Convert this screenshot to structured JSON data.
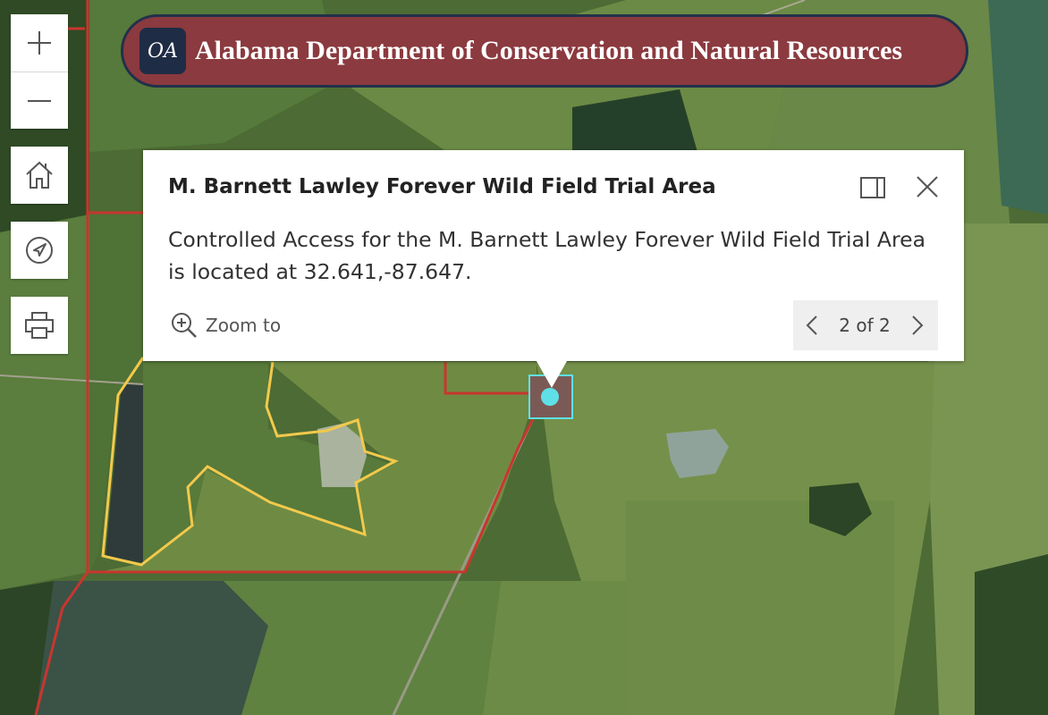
{
  "banner": {
    "logo_text": "OA",
    "title": "Alabama Department of Conservation and Natural Resources",
    "background_color": "#8b3a3f",
    "border_color": "#23304a"
  },
  "map_controls": {
    "zoom_in_icon": "plus-icon",
    "zoom_out_icon": "minus-icon",
    "home_icon": "home-icon",
    "locate_icon": "navigation-arrow-icon",
    "print_icon": "printer-icon"
  },
  "popup": {
    "title": "M. Barnett Lawley Forever Wild Field Trial Area",
    "body": "Controlled Access for the M. Barnett Lawley Forever Wild Field Trial Area is located at 32.641,-87.647.",
    "zoom_to_label": "Zoom to",
    "pager_label": "2 of 2",
    "dock_icon": "dock-panel-icon",
    "close_icon": "close-icon"
  },
  "map_colors": {
    "boundary_red": "#c8362e",
    "boundary_yellow": "#f2c94c",
    "selected_marker": "#5fe0e8"
  }
}
